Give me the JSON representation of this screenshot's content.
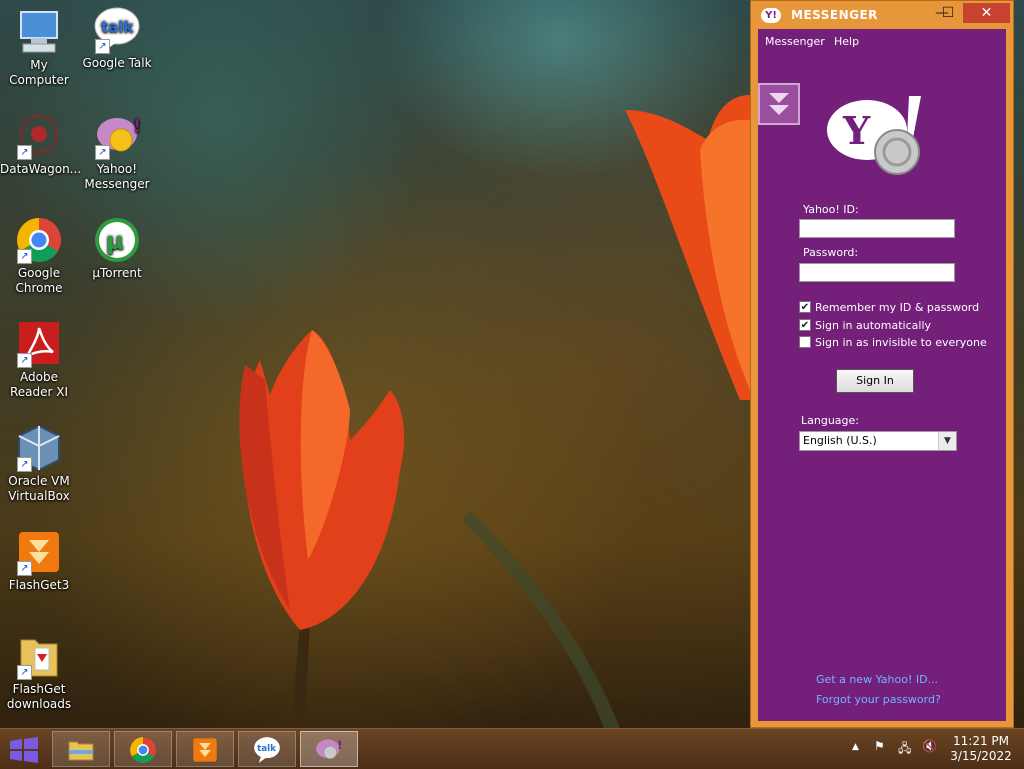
{
  "desktop": {
    "icons": [
      {
        "label": "My Computer",
        "icon": "my-computer-icon"
      },
      {
        "label": "Google Talk",
        "icon": "google-talk-icon"
      },
      {
        "label": "DataWagon...",
        "icon": "datawagon-icon"
      },
      {
        "label": "Yahoo! Messenger",
        "icon": "yahoo-messenger-icon"
      },
      {
        "label": "Google Chrome",
        "icon": "google-chrome-icon"
      },
      {
        "label": "µTorrent",
        "icon": "utorrent-icon"
      },
      {
        "label": "Adobe Reader XI",
        "icon": "adobe-reader-icon"
      },
      {
        "label": "Oracle VM VirtualBox",
        "icon": "virtualbox-icon"
      },
      {
        "label": "FlashGet3",
        "icon": "flashget-icon"
      },
      {
        "label": "FlashGet downloads",
        "icon": "folder-icon"
      }
    ]
  },
  "messenger": {
    "title": "MESSENGER",
    "logo_text": "Y!",
    "menu": [
      "Messenger",
      "Help"
    ],
    "yahoo_id_label": "Yahoo! ID:",
    "yahoo_id_value": "",
    "password_label": "Password:",
    "password_value": "",
    "checkboxes": [
      {
        "label": "Remember my ID & password",
        "checked": true
      },
      {
        "label": "Sign in automatically",
        "checked": true
      },
      {
        "label": "Sign in as invisible to everyone",
        "checked": false
      }
    ],
    "sign_in_label": "Sign In",
    "language_label": "Language:",
    "language_value": "English (U.S.)",
    "links": [
      "Get a new Yahoo! ID...",
      "Forgot your password?"
    ],
    "accent": "#74207a"
  },
  "taskbar": {
    "apps": [
      "file-explorer-icon",
      "google-chrome-icon",
      "flashget-icon",
      "google-talk-icon",
      "yahoo-messenger-icon"
    ],
    "time": "11:21 PM",
    "date": "3/15/2022"
  }
}
